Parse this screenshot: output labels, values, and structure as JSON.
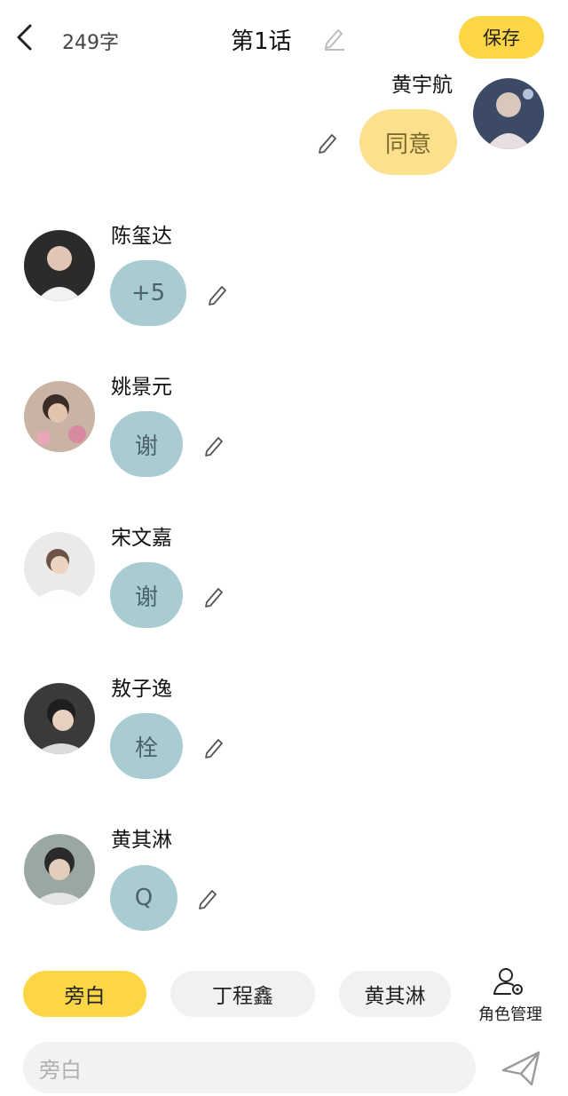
{
  "header": {
    "word_count": "249字",
    "title": "第1话",
    "save_label": "保存"
  },
  "messages": [
    {
      "name": "黄宇航",
      "text": "同意",
      "side": "right",
      "avatar_color": "#3c4a66"
    },
    {
      "name": "陈玺达",
      "text": "+5",
      "side": "left",
      "avatar_color": "#2b2b2b"
    },
    {
      "name": "姚景元",
      "text": "谢",
      "side": "left",
      "avatar_color": "#7a6258"
    },
    {
      "name": "宋文嘉",
      "text": "谢",
      "side": "left",
      "avatar_color": "#e4e0dc"
    },
    {
      "name": "敖子逸",
      "text": "栓",
      "side": "left",
      "avatar_color": "#3a3a3a"
    },
    {
      "name": "黄其淋",
      "text": "Q",
      "side": "left",
      "avatar_color": "#9aa7a3"
    }
  ],
  "roles": [
    "旁白",
    "丁程鑫",
    "黄其淋"
  ],
  "role_manage_label": "角色管理",
  "input": {
    "placeholder": "旁白"
  },
  "colors": {
    "accent": "#fdd646",
    "bubble_other": "#a9ccd3",
    "bubble_self": "#fde08d"
  }
}
